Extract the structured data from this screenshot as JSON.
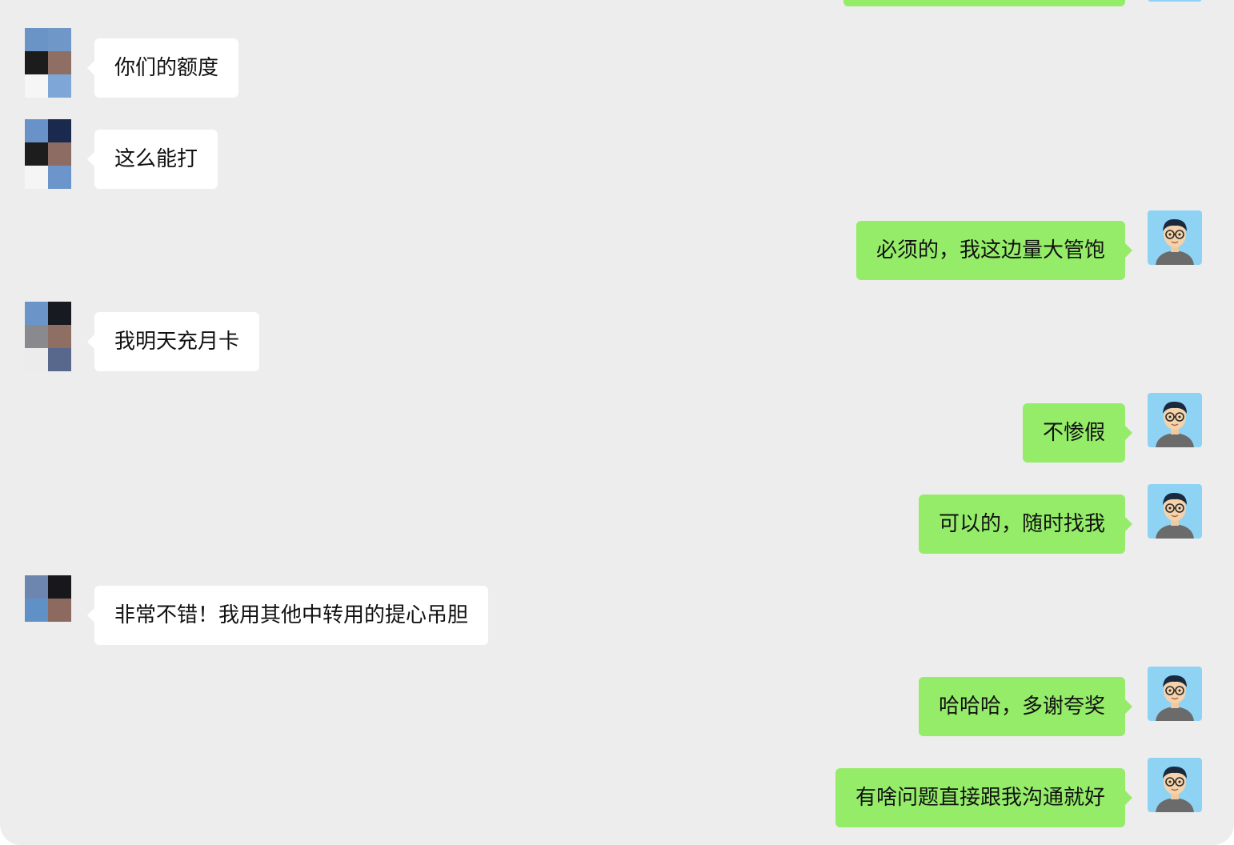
{
  "colors": {
    "background": "#ededed",
    "my_bubble": "#95ec69",
    "their_bubble": "#ffffff",
    "text": "#111111",
    "my_avatar_bg": "#8fd3f4"
  },
  "messages": [
    {
      "sender": "them",
      "text": "你们的额度",
      "avatar": "mosaic-avatar-icon"
    },
    {
      "sender": "them",
      "text": "这么能打",
      "avatar": "mosaic-avatar-icon"
    },
    {
      "sender": "me",
      "text": "必须的，我这边量大管饱",
      "avatar": "cartoon-avatar-icon"
    },
    {
      "sender": "them",
      "text": "我明天充月卡",
      "avatar": "mosaic-avatar-icon"
    },
    {
      "sender": "me",
      "text": "不惨假",
      "avatar": "cartoon-avatar-icon"
    },
    {
      "sender": "me",
      "text": "可以的，随时找我",
      "avatar": "cartoon-avatar-icon"
    },
    {
      "sender": "them",
      "text": "非常不错！我用其他中转用的提心吊胆",
      "avatar": "mosaic-avatar-icon"
    },
    {
      "sender": "me",
      "text": "哈哈哈，多谢夸奖",
      "avatar": "cartoon-avatar-icon"
    },
    {
      "sender": "me",
      "text": "有啥问题直接跟我沟通就好",
      "avatar": "cartoon-avatar-icon"
    }
  ]
}
